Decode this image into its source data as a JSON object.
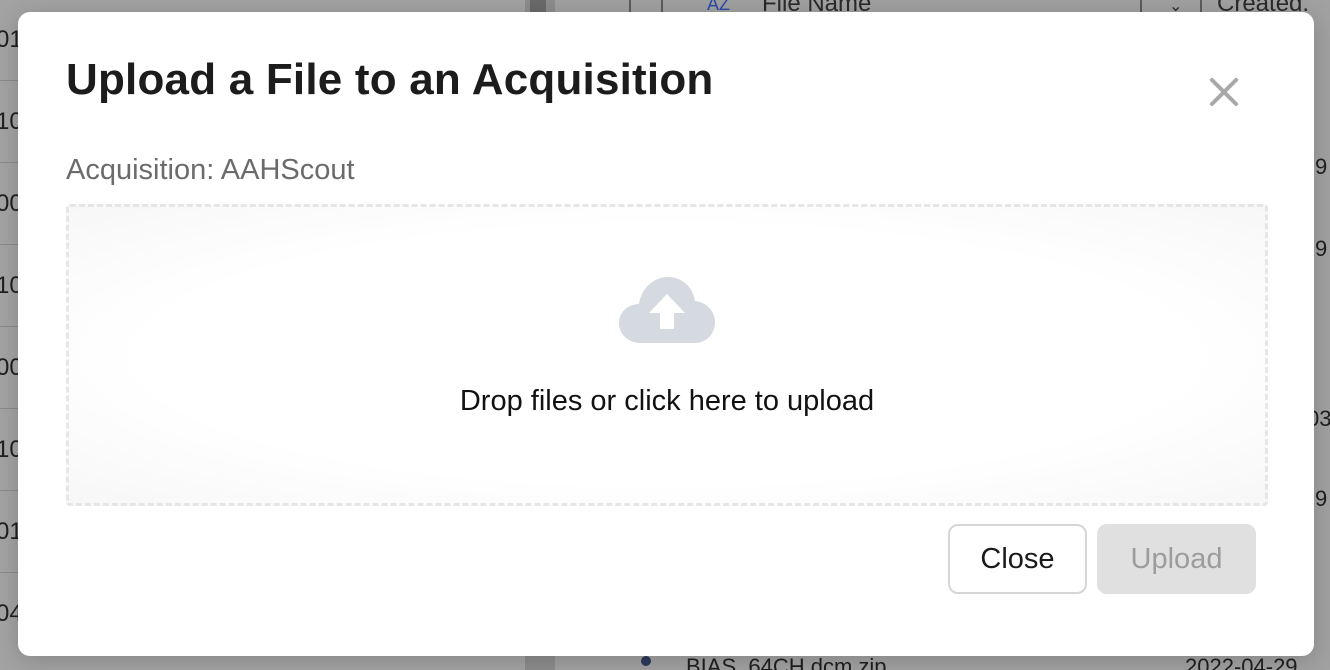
{
  "background": {
    "left_column_fragments": [
      "01",
      "10",
      "00",
      "10",
      "00",
      "10",
      "01",
      "04"
    ],
    "header_labels": {
      "sort_icon_text": "AZ",
      "file_name": "File Name",
      "created": "Created."
    },
    "right_fragments": [
      "9",
      "9",
      "03",
      "9"
    ],
    "bottom_row": {
      "file_name": "BIAS_64CH.dcm.zip",
      "created": "2022-04-29"
    }
  },
  "modal": {
    "title": "Upload a File to an Acquisition",
    "close_icon": "close-icon",
    "subtitle": "Acquisition: AAHScout",
    "dropzone": {
      "icon": "cloud-upload-icon",
      "text": "Drop files or click here to upload"
    },
    "buttons": {
      "close_label": "Close",
      "upload_label": "Upload"
    }
  },
  "colors": {
    "icon_gray": "#d5d9e0",
    "disabled_button_bg": "#e0e0e0",
    "disabled_button_text": "#9c9c9c"
  }
}
